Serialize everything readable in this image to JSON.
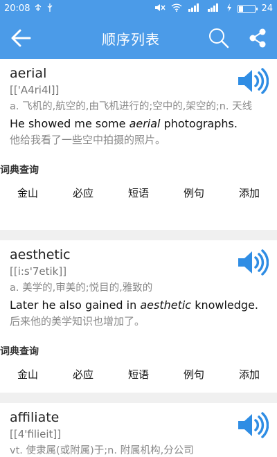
{
  "statusbar": {
    "time": "20:08",
    "battery": "24",
    "battery_level": 0.24,
    "icons": [
      "usb-tree-icon",
      "usb-icon",
      "mute-icon",
      "wifi-icon",
      "signal-icon",
      "signal-icon",
      "charging-icon",
      "battery-icon"
    ]
  },
  "header": {
    "title": "顺序列表",
    "icons": [
      "back-arrow-icon",
      "search-icon",
      "share-icon"
    ],
    "color": "#4b9be8"
  },
  "entries": [
    {
      "word": "aerial",
      "phonetic": "[['A4ri4l]]",
      "meaning": "a. 飞机的,航空的,由飞机进行的;空中的,架空的;n. 天线",
      "example_before": "He showed me some ",
      "example_word": "aerial",
      "example_after": " photographs.",
      "example_cn": "他给我看了一些空中拍摄的照片。"
    },
    {
      "word": "aesthetic",
      "phonetic": "[[i:s'7etik]]",
      "meaning": "a. 美学的,审美的;悦目的,雅致的",
      "example_before": "Later he also gained in ",
      "example_word": "aesthetic",
      "example_after": " knowledge.",
      "example_cn": "后来他的美学知识也增加了。"
    },
    {
      "word": "affiliate",
      "phonetic": "[[4'filieit]]",
      "meaning": "vt. 使隶属(或附属)于;n. 附属机构,分公司"
    }
  ],
  "dict": {
    "label": "词典查询",
    "buttons": [
      "金山",
      "必应",
      "短语",
      "例句",
      "添加"
    ]
  },
  "colors": {
    "accent": "#3a8fe0",
    "speaker": "#2f8de4"
  }
}
